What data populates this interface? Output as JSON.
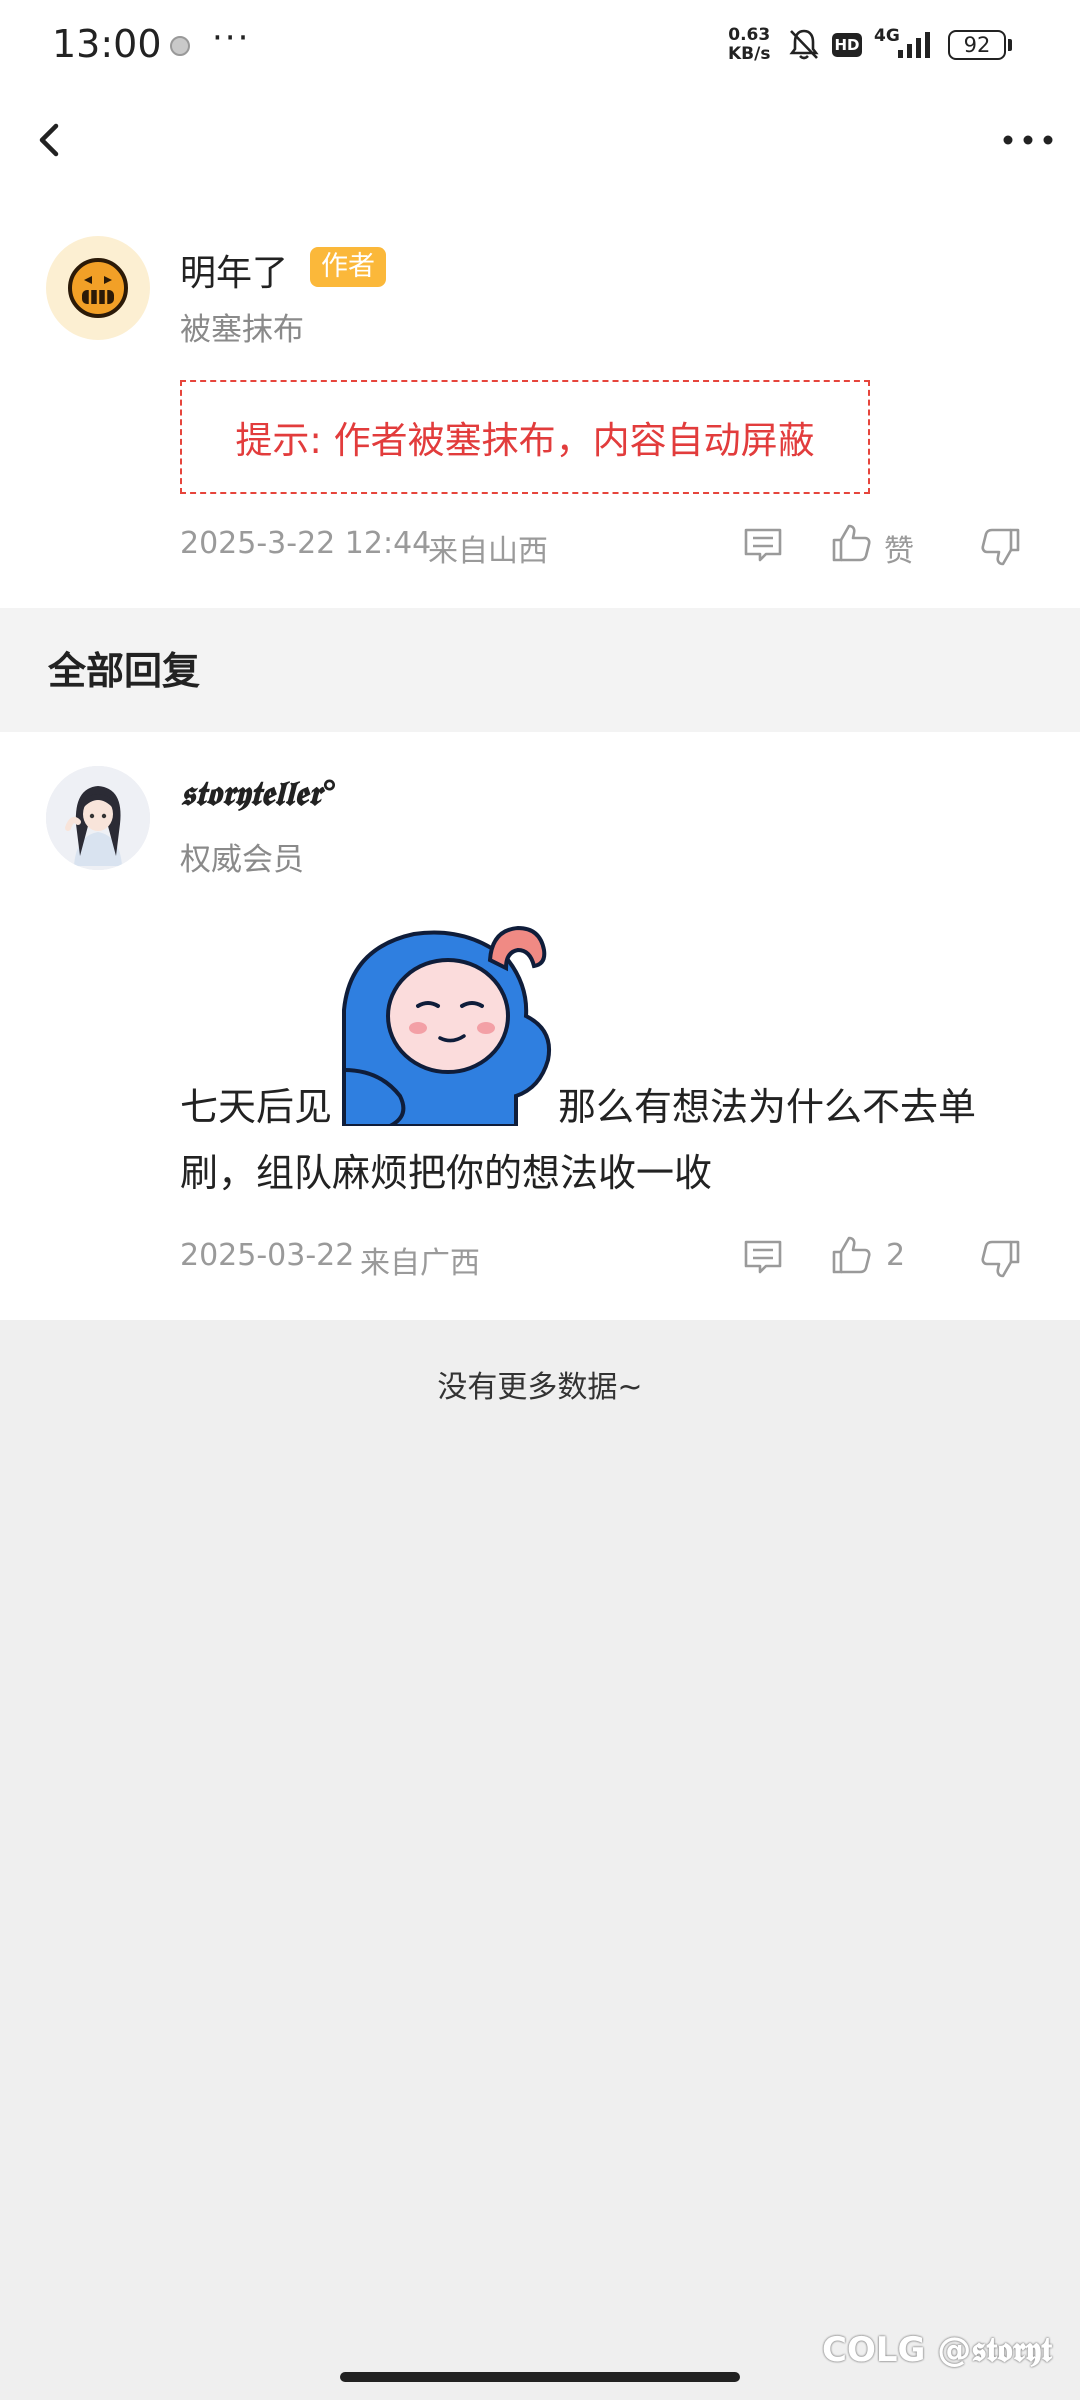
{
  "status_bar": {
    "time": "13:00",
    "more": "···",
    "net_speed_value": "0.63",
    "net_speed_unit": "KB/s",
    "hd_label": "HD",
    "network": "4G",
    "battery": "92"
  },
  "post": {
    "author_name": "明年了",
    "author_badge": "作者",
    "author_subtitle": "被塞抹布",
    "notice": "提示: 作者被塞抹布，内容自动屏蔽",
    "date": "2025-3-22 12:44",
    "location": "来自山西",
    "like_label": "赞"
  },
  "section": {
    "title": "全部回复"
  },
  "reply": {
    "author_name": "𝖘𝖙𝖔𝖗𝖞𝖙𝖊𝖑𝖑𝖊𝖗°",
    "author_subtitle": "权威会员",
    "text_part1": "七天后见",
    "text_part2": "那么有想法为什么不去单",
    "text_part3": "刷，组队麻烦把你的想法收一收",
    "date": "2025-03-22",
    "location": "来自广西",
    "like_count": "2"
  },
  "footer": {
    "no_more": "没有更多数据~",
    "watermark": "COLG @𝖘𝖙𝖔𝖗𝖞𝖙"
  }
}
